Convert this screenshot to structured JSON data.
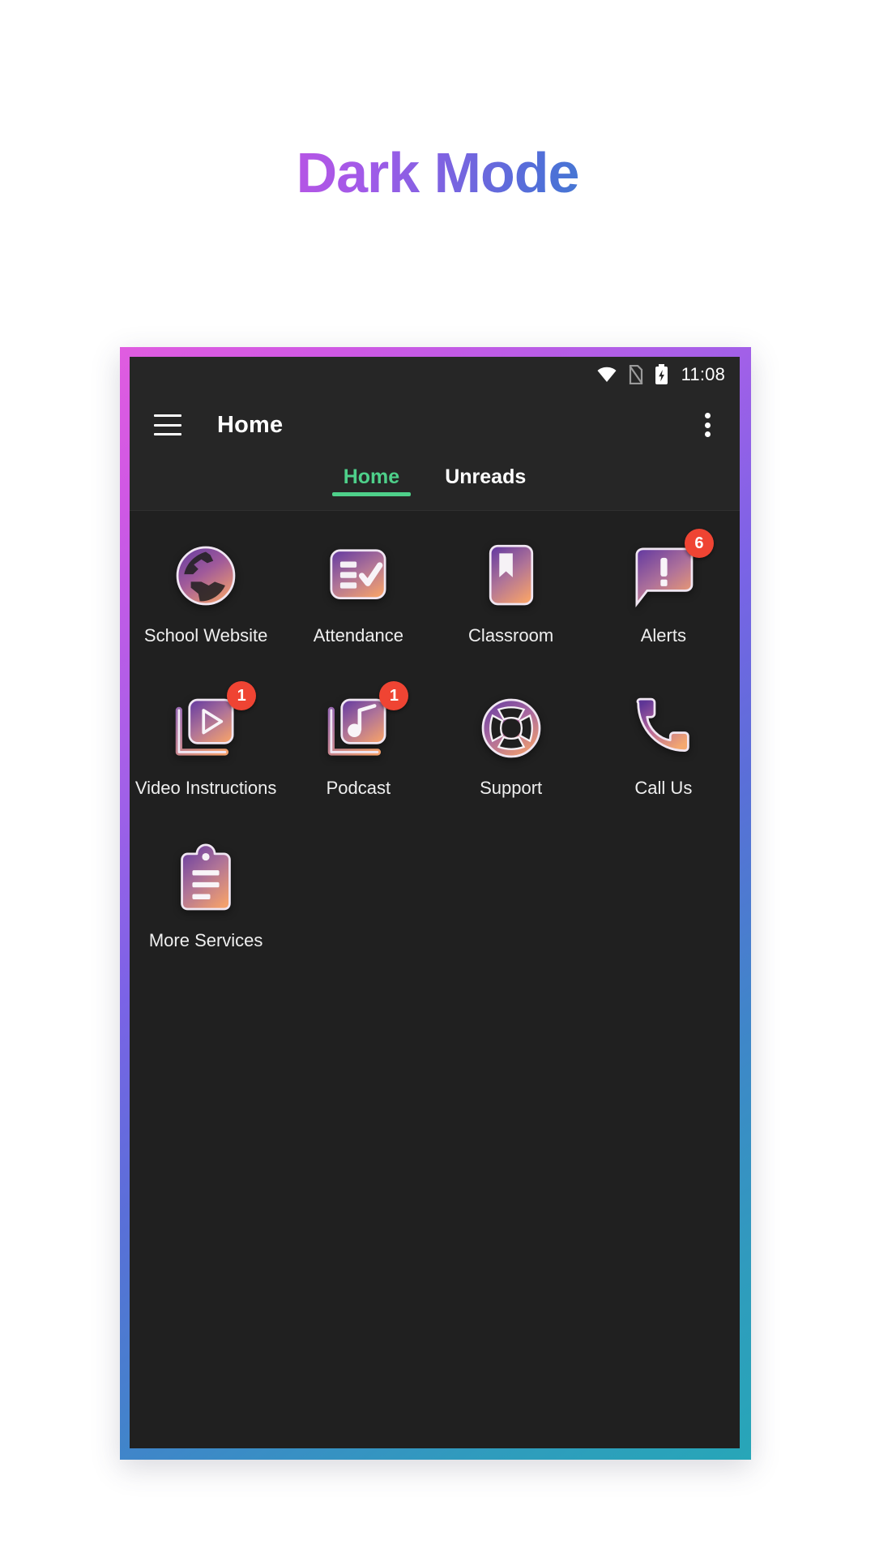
{
  "page": {
    "title": "Dark Mode",
    "background_color": "#ffffff"
  },
  "frame": {
    "gradient_start": "#e05ce0",
    "gradient_mid": "#5a6fd8",
    "gradient_end": "#27a6b8"
  },
  "phone": {
    "screen_background": "#202020",
    "bar_background": "#262626",
    "status_bar": {
      "time": "11:08",
      "icons": [
        "wifi-icon",
        "sim-card-off-icon",
        "battery-charging-icon"
      ]
    },
    "app_bar": {
      "menu_icon": "hamburger-menu-icon",
      "title": "Home",
      "overflow_icon": "more-vertical-icon"
    },
    "tabs": {
      "active_color": "#4ed08a",
      "items": [
        {
          "label": "Home",
          "active": true
        },
        {
          "label": "Unreads",
          "active": false
        }
      ]
    },
    "grid": {
      "badge_color": "#ef4433",
      "icon_gradient_top": "#6b3fa0",
      "icon_gradient_bottom": "#f2a06a",
      "items": [
        {
          "label": "School Website",
          "icon": "globe-icon",
          "badge": ""
        },
        {
          "label": "Attendance",
          "icon": "checklist-icon",
          "badge": ""
        },
        {
          "label": "Classroom",
          "icon": "bookmark-book-icon",
          "badge": ""
        },
        {
          "label": "Alerts",
          "icon": "alert-speech-bubble-icon",
          "badge": "6"
        },
        {
          "label": "Video Instructions",
          "icon": "video-play-stack-icon",
          "badge": "1"
        },
        {
          "label": "Podcast",
          "icon": "music-note-stack-icon",
          "badge": "1"
        },
        {
          "label": "Support",
          "icon": "lifebuoy-icon",
          "badge": ""
        },
        {
          "label": "Call Us",
          "icon": "phone-handset-icon",
          "badge": ""
        },
        {
          "label": "More Services",
          "icon": "clipboard-list-icon",
          "badge": ""
        }
      ]
    }
  }
}
